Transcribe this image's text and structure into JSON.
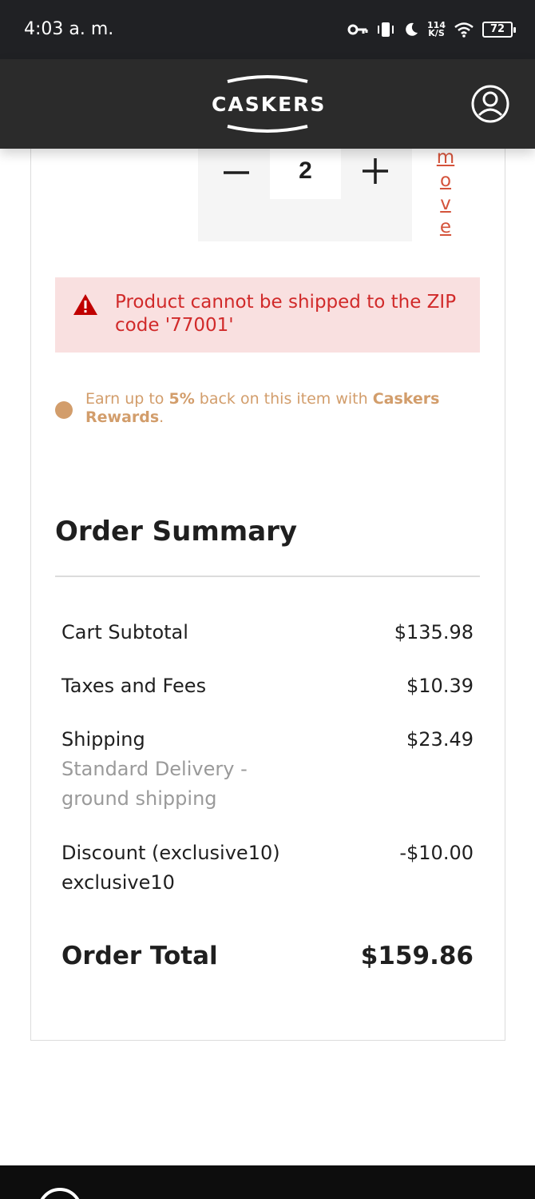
{
  "status_bar": {
    "time": "4:03 a. m.",
    "net_speed_value": "114",
    "net_speed_unit": "K/S",
    "battery": "72"
  },
  "header": {
    "logo_text": "CASKERS",
    "account_icon": "account-circle-icon"
  },
  "cart_item": {
    "quantity": "2",
    "remove_letters": [
      "m",
      "o",
      "v",
      "e"
    ],
    "error_message": "Product cannot be shipped to the ZIP code '77001'",
    "rewards": {
      "prefix": "Earn up to ",
      "percent": "5%",
      "middle": " back on this item with ",
      "brand": "Caskers Rewards",
      "suffix": "."
    }
  },
  "order_summary": {
    "title": "Order Summary",
    "cart_subtotal_label": "Cart Subtotal",
    "cart_subtotal_value": "$135.98",
    "taxes_label": "Taxes and Fees",
    "taxes_value": "$10.39",
    "shipping_label": "Shipping",
    "shipping_method": "Standard Delivery - ground shipping",
    "shipping_value": "$23.49",
    "discount_label": "Discount (exclusive10)",
    "discount_code": "exclusive10",
    "discount_value": "-$10.00",
    "total_label": "Order Total",
    "total_value": "$159.86"
  },
  "colors": {
    "header_bg": "#2b2b2b",
    "error_text": "#d12a2a",
    "error_bg": "#f9e0e0",
    "rewards": "#d29d6b",
    "remove_link": "#d4533b"
  }
}
